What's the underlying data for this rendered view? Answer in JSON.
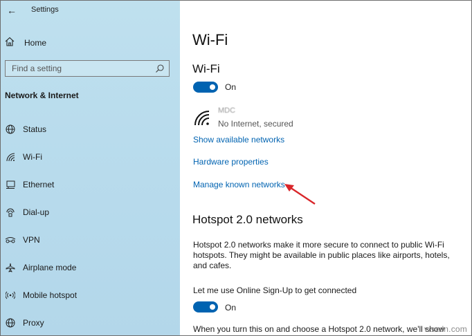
{
  "window": {
    "back_glyph": "←",
    "title": "Settings"
  },
  "sidebar": {
    "home_label": "Home",
    "search": {
      "placeholder": "Find a setting",
      "icon": "search-icon"
    },
    "section_title": "Network & Internet",
    "items": [
      {
        "label": "Status",
        "icon": "globe-icon"
      },
      {
        "label": "Wi-Fi",
        "icon": "wifi-icon"
      },
      {
        "label": "Ethernet",
        "icon": "ethernet-icon"
      },
      {
        "label": "Dial-up",
        "icon": "dialup-icon"
      },
      {
        "label": "VPN",
        "icon": "vpn-icon"
      },
      {
        "label": "Airplane mode",
        "icon": "airplane-icon"
      },
      {
        "label": "Mobile hotspot",
        "icon": "hotspot-icon"
      },
      {
        "label": "Proxy",
        "icon": "globe-icon"
      }
    ]
  },
  "main": {
    "page_title": "Wi-Fi",
    "wifi_heading": "Wi-Fi",
    "wifi_toggle": {
      "state": "On",
      "on": true
    },
    "network": {
      "name": "MDC",
      "status": "No Internet, secured"
    },
    "links": {
      "show_available": "Show available networks",
      "hardware_properties": "Hardware properties",
      "manage_known": "Manage known networks"
    },
    "hotspot": {
      "heading": "Hotspot 2.0 networks",
      "description": "Hotspot 2.0 networks make it more secure to connect to public Wi-Fi hotspots. They might be available in public places like airports, hotels, and cafes.",
      "online_signup_label": "Let me use Online Sign-Up to get connected",
      "online_signup_toggle": {
        "state": "On",
        "on": true
      },
      "footer_text": "When you turn this on and choose a Hotspot 2.0 network, we'll show"
    },
    "watermark": "wsxdn.com"
  },
  "colors": {
    "accent": "#0063b1",
    "sidebar_bg": "#bfe0ee",
    "arrow": "#d9262a"
  }
}
